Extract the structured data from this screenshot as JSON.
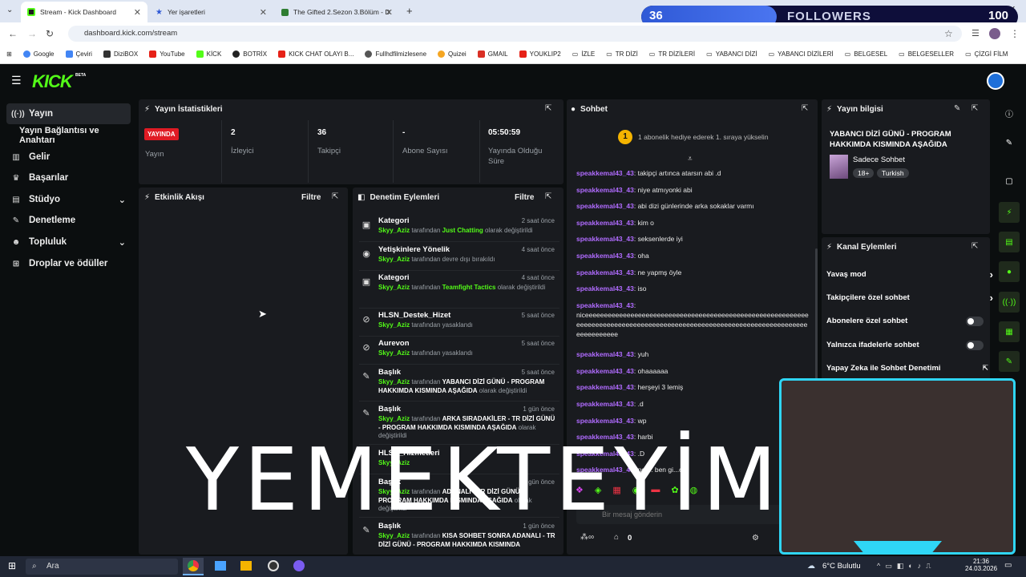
{
  "browser": {
    "tabs": [
      {
        "title": "Stream - Kick Dashboard",
        "active": true
      },
      {
        "title": "Yer işaretleri",
        "active": false
      },
      {
        "title": "The Gifted 2.Sezon 3.Bölüm - D",
        "active": false
      }
    ],
    "new_tab": "+",
    "url": "dashboard.kick.com/stream",
    "bookmarks": [
      "Google",
      "Çeviri",
      "DiziBOX",
      "YouTube",
      "KİCK",
      "BOTRİX",
      "KICK CHAT OLAYI B...",
      "Fullhdfilmizlesene",
      "Quizei",
      "GMAIL",
      "YOUKLIP2",
      "İZLE",
      "TR DİZİ",
      "TR DİZİLERİ",
      "YABANCI DİZİ",
      "YABANCI DİZİLERİ",
      "BELGESEL",
      "BELGESELLER",
      "ÇİZGİ FİLM"
    ]
  },
  "followers_overlay": {
    "count": "36",
    "label": "FOLLOWERS",
    "goal": "100",
    "progress": 0.36
  },
  "header": {
    "logo": "KICK",
    "beta": "BETA"
  },
  "sidebar": {
    "items": [
      {
        "label": "Yayın",
        "icon": "broadcast-icon"
      },
      {
        "label": "Yayın Bağlantısı ve Anahtarı"
      },
      {
        "label": "Gelir",
        "icon": "bank-icon"
      },
      {
        "label": "Başarılar",
        "icon": "trophy-icon"
      },
      {
        "label": "Stüdyo",
        "icon": "studio-icon"
      },
      {
        "label": "Denetleme",
        "icon": "wrench-icon"
      },
      {
        "label": "Topluluk",
        "icon": "community-icon"
      },
      {
        "label": "Droplar ve ödüller",
        "icon": "gift-icon"
      }
    ]
  },
  "stats": {
    "title": "Yayın İstatistikleri",
    "live_badge": "YAYINDA",
    "live_label": "Yayın",
    "viewers": {
      "value": "2",
      "label": "İzleyici"
    },
    "followers": {
      "value": "36",
      "label": "Takipçi"
    },
    "subs": {
      "value": "-",
      "label": "Abone Sayısı"
    },
    "uptime": {
      "value": "05:50:59",
      "label": "Yayında Olduğu Süre"
    }
  },
  "activity": {
    "title": "Etkinlik Akışı",
    "filter": "Filtre"
  },
  "audit": {
    "title": "Denetim Eylemleri",
    "filter": "Filtre",
    "rows": [
      {
        "title": "Kategori",
        "time": "2 saat önce",
        "by": "Skyy_Aziz",
        "pre": "tarafından",
        "value": "Just Chatting",
        "post": "olarak değiştirildi"
      },
      {
        "title": "Yetişkinlere Yönelik",
        "time": "4 saat önce",
        "by": "Skyy_Aziz",
        "pre": "tarafından devre dışı bırakıldı",
        "value": "",
        "post": ""
      },
      {
        "title": "Kategori",
        "time": "4 saat önce",
        "by": "Skyy_Aziz",
        "pre": "tarafından",
        "value": "Teamfight Tactics",
        "post": "olarak değiştirildi"
      },
      {
        "title": "HLSN_Destek_Hizet",
        "time": "5 saat önce",
        "by": "Skyy_Aziz",
        "pre": "tarafından yasaklandı",
        "value": "",
        "post": ""
      },
      {
        "title": "Aurevon",
        "time": "5 saat önce",
        "by": "Skyy_Aziz",
        "pre": "tarafından yasaklandı",
        "value": "",
        "post": ""
      },
      {
        "title": "Başlık",
        "time": "5 saat önce",
        "by": "Skyy_Aziz",
        "pre": "tarafından",
        "value": "YABANCI DİZİ GÜNÜ - PROGRAM HAKKIMDA KISMINDA AŞAĞIDA",
        "post": "olarak değiştirildi"
      },
      {
        "title": "Başlık",
        "time": "1 gün önce",
        "by": "Skyy_Aziz",
        "pre": "tarafından",
        "value": "ARKA SIRADAKİLER - TR DİZİ GÜNÜ - PROGRAM HAKKIMDA KISMINDA AŞAĞIDA",
        "post": "olarak değiştirildi"
      },
      {
        "title": "HLSN_Hizmetleri",
        "time": "",
        "by": "Skyy_Aziz",
        "pre": "",
        "value": "",
        "post": ""
      },
      {
        "title": "Başlık",
        "time": "1 gün önce",
        "by": "Skyy_Aziz",
        "pre": "tarafından",
        "value": "ADANALI - TR DİZİ GÜNÜ - PROGRAM HAKKIMDA KISMINDA AŞAĞIDA",
        "post": "olarak değiştirildi"
      },
      {
        "title": "Başlık",
        "time": "1 gün önce",
        "by": "Skyy_Aziz",
        "pre": "tarafından",
        "value": "KISA SOHBET SONRA ADANALI - TR DİZİ GÜNÜ - PROGRAM HAKKIMDA KISMINDA",
        "post": ""
      }
    ]
  },
  "chat": {
    "title": "Sohbet",
    "pinned_rank": "1",
    "pinned_text": "1 abonelik hediye ederek 1. sıraya yükselin",
    "user": "speakkemal43_43",
    "messages": [
      "takipçi artınca atarsın abi .d",
      "niye atmıyonki abi",
      "abi dizi günlerinde arka sokaklar varmı",
      "kim o",
      "seksenlerde iyi",
      "oha",
      "ne yapmş öyle",
      "iso",
      "niceeeeeeeeeeeeeeeeeeeeeeeeeeeeeeeeeeeeeeeeeeeeeeeeeeeeeeeeeeeeeeeeeeeeeeeeeeeeeeeeeeeeeeeeeeeeeeeeeeeeeeeeeeeeeeeeeeeeeeeeeeeeeeeeeee",
      "yuh",
      "ohaaaaaa",
      "herşeyi 3 lemiş",
      ".d",
      "wp",
      "harbi",
      ".D",
      "ne ... ben gi...om"
    ],
    "input_placeholder": "Bir mesaj gönderin",
    "points": "0"
  },
  "stream_info": {
    "title": "Yayın bilgisi",
    "stream_title": "YABANCI DİZİ GÜNÜ - PROGRAM HAKKIMDA KISMINDA AŞAĞIDA",
    "category": "Sadece Sohbet",
    "tags": [
      "18+",
      "Turkish"
    ]
  },
  "channel_actions": {
    "title": "Kanal Eylemleri",
    "items": [
      {
        "label": "Yavaş mod",
        "kind": "arrow"
      },
      {
        "label": "Takipçilere özel sohbet",
        "kind": "arrow"
      },
      {
        "label": "Abonelere özel sohbet",
        "kind": "toggle"
      },
      {
        "label": "Yalnızca ifadelerle sohbet",
        "kind": "toggle"
      },
      {
        "label": "Yapay Zeka ile Sohbet Denetimi",
        "kind": "external"
      }
    ]
  },
  "overlay_text": "YEMEKTEYİM",
  "taskbar": {
    "search": "Ara",
    "weather": "6°C  Bulutlu",
    "time": "21:36",
    "date": "24.03.2026"
  },
  "colors": {
    "kick_green": "#53fc18",
    "live_red": "#e01b24",
    "username_purple": "#b06bff",
    "panel_bg": "#191b1f"
  }
}
